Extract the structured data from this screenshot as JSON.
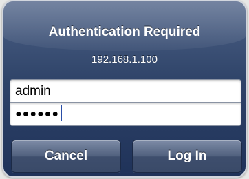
{
  "dialog": {
    "title": "Authentication Required",
    "host": "192.168.1.100"
  },
  "fields": {
    "username_value": "admin",
    "password_masked": "●●●●●●"
  },
  "buttons": {
    "cancel_label": "Cancel",
    "login_label": "Log In"
  },
  "colors": {
    "dialog_top": "#4d6186",
    "dialog_bottom": "#1f3259",
    "button_face": "#52627f",
    "caret": "#2a4ea7"
  }
}
